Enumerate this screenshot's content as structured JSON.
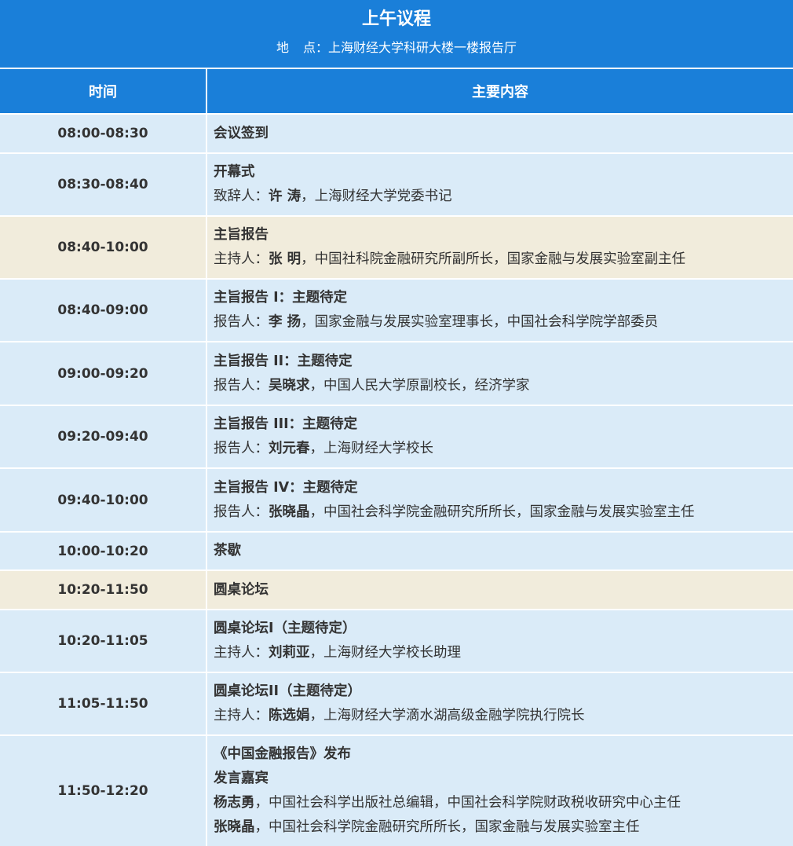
{
  "header": {
    "title": "上午议程",
    "venue_label_a": "地",
    "venue_label_b": "点：",
    "venue_value": "上海财经大学科研大楼一楼报告厅"
  },
  "columns": {
    "time": "时间",
    "content": "主要内容"
  },
  "rows": [
    {
      "time": "08:00-08:30",
      "title": "会议签到",
      "lines": []
    },
    {
      "time": "08:30-08:40",
      "title": "开幕式",
      "lines": [
        {
          "role": "致辞人：",
          "name": "许 涛",
          "desc": "，上海财经大学党委书记"
        }
      ]
    },
    {
      "time": "08:40-10:00",
      "title": "主旨报告",
      "lines": [
        {
          "role": "主持人：",
          "name": "张 明",
          "desc": "，中国社科院金融研究所副所长，国家金融与发展实验室副主任"
        }
      ]
    },
    {
      "time": "08:40-09:00",
      "title": "主旨报告 I：主题待定",
      "lines": [
        {
          "role": "报告人：",
          "name": "李 扬",
          "desc": "，国家金融与发展实验室理事长，中国社会科学院学部委员"
        }
      ]
    },
    {
      "time": "09:00-09:20",
      "title": "主旨报告 II：主题待定",
      "lines": [
        {
          "role": "报告人：",
          "name": "吴晓求",
          "desc": "，中国人民大学原副校长，经济学家"
        }
      ]
    },
    {
      "time": "09:20-09:40",
      "title": "主旨报告 III：主题待定",
      "lines": [
        {
          "role": "报告人：",
          "name": "刘元春",
          "desc": "，上海财经大学校长"
        }
      ]
    },
    {
      "time": "09:40-10:00",
      "title": "主旨报告 IV：主题待定",
      "lines": [
        {
          "role": "报告人：",
          "name": "张晓晶",
          "desc": "，中国社会科学院金融研究所所长，国家金融与发展实验室主任"
        }
      ]
    },
    {
      "time": "10:00-10:20",
      "title": "茶歇",
      "lines": []
    },
    {
      "time": "10:20-11:50",
      "title": "圆桌论坛",
      "lines": []
    },
    {
      "time": "10:20-11:05",
      "title": "圆桌论坛I（主题待定）",
      "lines": [
        {
          "role": "主持人：",
          "name": "刘莉亚",
          "desc": "，上海财经大学校长助理"
        }
      ]
    },
    {
      "time": "11:05-11:50",
      "title": "圆桌论坛II（主题待定）",
      "lines": [
        {
          "role": "主持人：",
          "name": "陈选娟",
          "desc": "，上海财经大学滴水湖高级金融学院执行院长"
        }
      ]
    },
    {
      "time": "11:50-12:20",
      "title": "《中国金融报告》发布",
      "subtitle": "发言嘉宾",
      "lines": [
        {
          "role": "",
          "name": "杨志勇",
          "desc": "，中国社会科学出版社总编辑，中国社会科学院财政税收研究中心主任"
        },
        {
          "role": "",
          "name": "张晓晶",
          "desc": "，中国社会科学院金融研究所所长，国家金融与发展实验室主任"
        }
      ]
    }
  ]
}
